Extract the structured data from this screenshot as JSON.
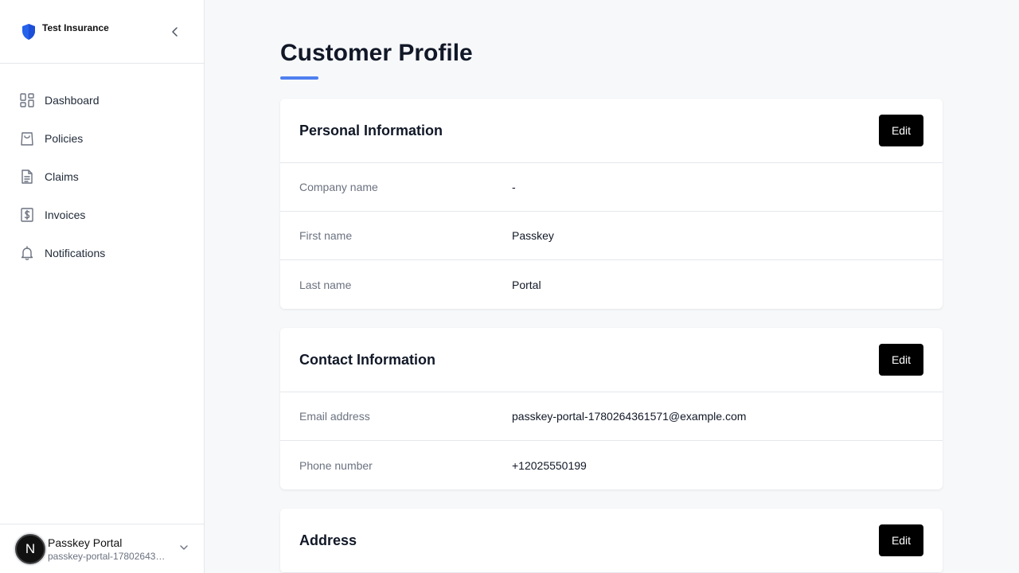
{
  "brand": {
    "name": "Test Insurance"
  },
  "nav": [
    {
      "label": "Dashboard",
      "icon": "dashboard-icon"
    },
    {
      "label": "Policies",
      "icon": "shopping-bag-icon"
    },
    {
      "label": "Claims",
      "icon": "document-icon"
    },
    {
      "label": "Invoices",
      "icon": "dollar-receipt-icon"
    },
    {
      "label": "Notifications",
      "icon": "bell-icon"
    }
  ],
  "user": {
    "initial": "N",
    "name": "Passkey Portal",
    "email": "passkey-portal-1780264361571@example.com"
  },
  "page": {
    "title": "Customer Profile"
  },
  "colors": {
    "accent": "#4f7ff0",
    "brand": "#2563eb",
    "button": "#000000"
  },
  "sections": {
    "personal": {
      "title": "Personal Information",
      "edit": "Edit",
      "rows": [
        {
          "label": "Company name",
          "value": "-"
        },
        {
          "label": "First name",
          "value": "Passkey"
        },
        {
          "label": "Last name",
          "value": "Portal"
        }
      ]
    },
    "contact": {
      "title": "Contact Information",
      "edit": "Edit",
      "rows": [
        {
          "label": "Email address",
          "value": "passkey-portal-1780264361571@example.com"
        },
        {
          "label": "Phone number",
          "value": "+12025550199"
        }
      ]
    },
    "address": {
      "title": "Address",
      "edit": "Edit"
    }
  }
}
